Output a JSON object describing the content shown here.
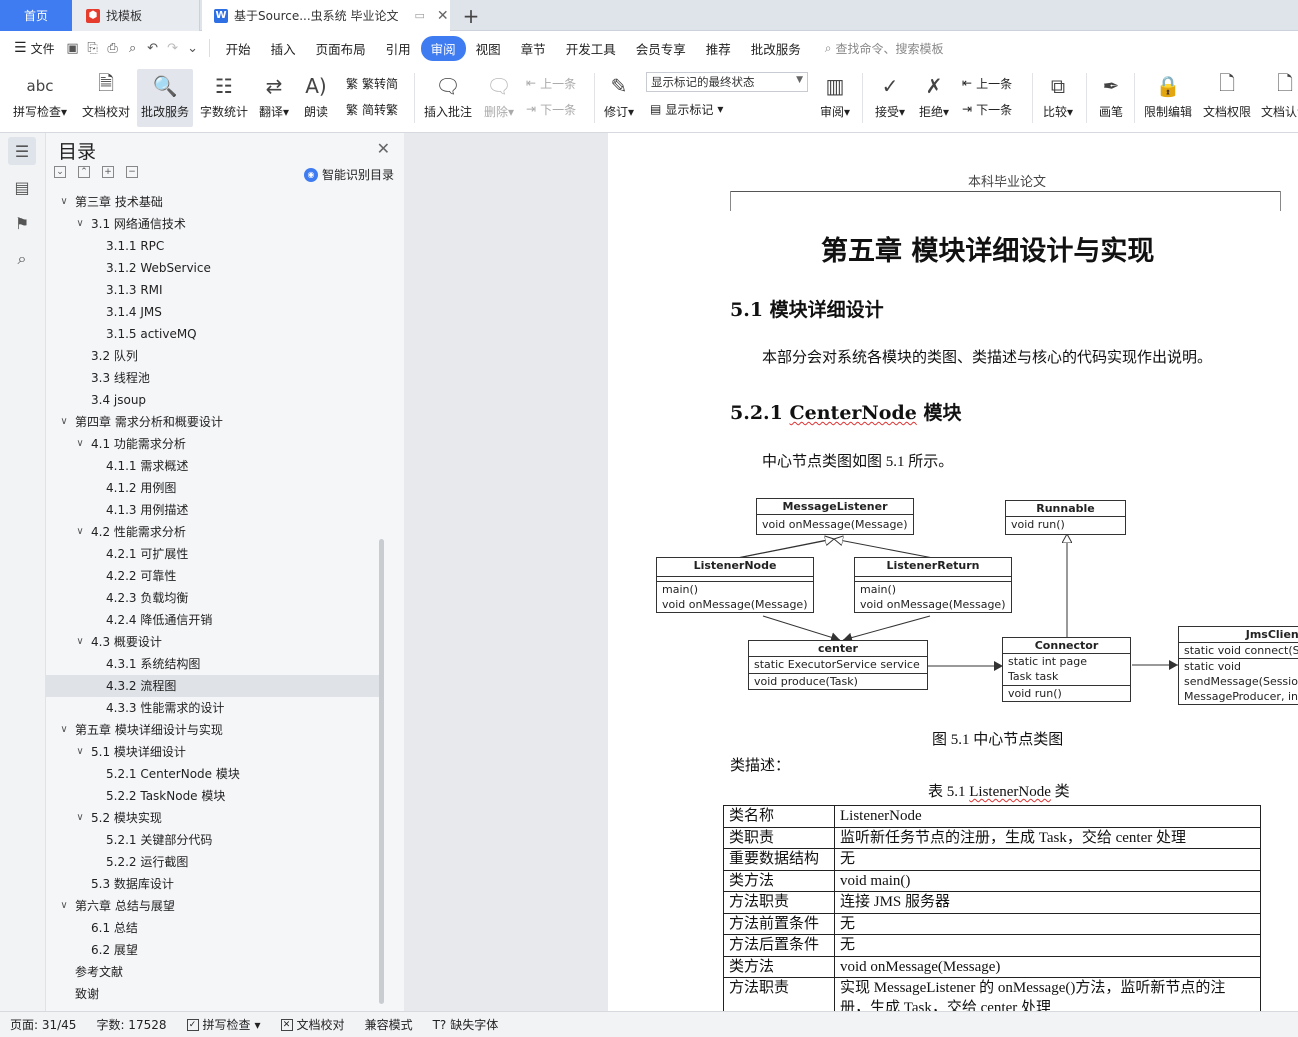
{
  "tabs": {
    "home": "首页",
    "template": "找模板",
    "document": "基于Source...虫系统 毕业论文"
  },
  "menu": {
    "file": "文件",
    "items": [
      "开始",
      "插入",
      "页面布局",
      "引用",
      "审阅",
      "视图",
      "章节",
      "开发工具",
      "会员专享",
      "推荐",
      "批改服务"
    ],
    "active_index": 4,
    "search_placeholder": "查找命令、搜索模板"
  },
  "ribbon": {
    "spell_icon_text": "abc",
    "spell": "拼写检查",
    "doc_check": "文档校对",
    "correction": "批改服务",
    "word_count": "字数统计",
    "translate": "翻译",
    "read_aloud": "朗读",
    "trad_to_simp": "繁转简",
    "simp_to_trad": "简转繁",
    "insert_comment": "插入批注",
    "delete": "删除",
    "prev": "上一条",
    "next": "下一条",
    "track": "修订",
    "markup_select": "显示标记的最终状态",
    "show_markup": "显示标记",
    "review": "审阅",
    "accept": "接受",
    "reject": "拒绝",
    "prev2": "上一条",
    "next2": "下一条",
    "compare": "比较",
    "brush": "画笔",
    "restrict": "限制编辑",
    "permission": "文档权限",
    "cert": "文档认证"
  },
  "toc": {
    "title": "目录",
    "smart": "智能识别目录",
    "items": [
      {
        "text": "第三章  技术基础",
        "level": 0,
        "chev": "v"
      },
      {
        "text": "3.1  网络通信技术",
        "level": 1,
        "chev": "v"
      },
      {
        "text": "3.1.1 RPC",
        "level": 2
      },
      {
        "text": "3.1.2 WebService",
        "level": 2
      },
      {
        "text": "3.1.3 RMI",
        "level": 2
      },
      {
        "text": "3.1.4 JMS",
        "level": 2
      },
      {
        "text": "3.1.5 activeMQ",
        "level": 2
      },
      {
        "text": "3.2  队列",
        "level": 1
      },
      {
        "text": "3.3  线程池",
        "level": 1
      },
      {
        "text": "3.4 jsoup",
        "level": 1
      },
      {
        "text": "第四章  需求分析和概要设计",
        "level": 0,
        "chev": "v"
      },
      {
        "text": "4.1  功能需求分析",
        "level": 1,
        "chev": "v"
      },
      {
        "text": "4.1.1  需求概述",
        "level": 2
      },
      {
        "text": "4.1.2  用例图",
        "level": 2
      },
      {
        "text": "4.1.3  用例描述",
        "level": 2
      },
      {
        "text": "4.2  性能需求分析",
        "level": 1,
        "chev": "v"
      },
      {
        "text": "4.2.1  可扩展性",
        "level": 2
      },
      {
        "text": "4.2.2  可靠性",
        "level": 2
      },
      {
        "text": "4.2.3  负载均衡",
        "level": 2
      },
      {
        "text": "4.2.4  降低通信开销",
        "level": 2
      },
      {
        "text": "4.3  概要设计",
        "level": 1,
        "chev": "v"
      },
      {
        "text": "4.3.1  系统结构图",
        "level": 2
      },
      {
        "text": "4.3.2  流程图",
        "level": 2,
        "selected": true
      },
      {
        "text": "4.3.3  性能需求的设计",
        "level": 2
      },
      {
        "text": "第五章  模块详细设计与实现",
        "level": 0,
        "chev": "v"
      },
      {
        "text": "5.1  模块详细设计",
        "level": 1,
        "chev": "v"
      },
      {
        "text": "5.2.1 CenterNode 模块",
        "level": 2
      },
      {
        "text": "5.2.2 TaskNode 模块",
        "level": 2
      },
      {
        "text": "5.2  模块实现",
        "level": 1,
        "chev": "v"
      },
      {
        "text": "5.2.1  关键部分代码",
        "level": 2
      },
      {
        "text": "5.2.2  运行截图",
        "level": 2
      },
      {
        "text": "5.3  数据库设计",
        "level": 1
      },
      {
        "text": "第六章  总结与展望",
        "level": 0,
        "chev": "v"
      },
      {
        "text": "6.1  总结",
        "level": 1
      },
      {
        "text": "6.2  展望",
        "level": 1
      },
      {
        "text": "参考文献",
        "level": 0
      },
      {
        "text": "致谢",
        "level": 0
      }
    ]
  },
  "page": {
    "header": "本科毕业论文",
    "chapter_title": "第五章  模块详细设计与实现",
    "section_title": "5.1  模块详细设计",
    "intro": "本部分会对系统各模块的类图、类描述与核心的代码实现作出说明。",
    "subsection_num": "5.2.1 ",
    "subsection_name": "CenterNode",
    "subsection_suffix": " 模块",
    "figure_ref": "中心节点类图如图 5.1 所示。",
    "figure_caption": "图 5.1  中心节点类图",
    "class_desc": "类描述：",
    "table_caption_prefix": "表 5.1 ",
    "table_caption_name": "ListenerNode",
    "table_caption_suffix": " 类"
  },
  "uml": {
    "message_listener": {
      "name": "MessageListener",
      "methods": [
        "void onMessage(Message)"
      ]
    },
    "runnable": {
      "name": "Runnable",
      "methods": [
        "void run()"
      ]
    },
    "listener_node": {
      "name": "ListenerNode",
      "methods": [
        "main()",
        "void onMessage(Message)"
      ]
    },
    "listener_return": {
      "name": "ListenerReturn",
      "methods": [
        "main()",
        "void onMessage(Message)"
      ]
    },
    "center": {
      "name": "center",
      "attrs": [
        "static ExecutorService service"
      ],
      "methods": [
        "void produce(Task)"
      ]
    },
    "connector": {
      "name": "Connector",
      "attrs": [
        "static int page",
        "Task task"
      ],
      "methods": [
        "void run()"
      ]
    },
    "jms_client": {
      "name": "JmsClient",
      "methods": [
        "static void connect(Str",
        "static void",
        "sendMessage(Session",
        "MessageProducer, int)"
      ]
    }
  },
  "table": [
    {
      "k": "类名称",
      "v": "ListenerNode"
    },
    {
      "k": "类职责",
      "v": "监听新任务节点的注册，生成 Task，交给 center 处理"
    },
    {
      "k": "重要数据结构",
      "v": "无"
    },
    {
      "k": "类方法",
      "v": "void main()"
    },
    {
      "k": "方法职责",
      "v": "连接 JMS 服务器"
    },
    {
      "k": "方法前置条件",
      "v": "无"
    },
    {
      "k": "方法后置条件",
      "v": "无"
    },
    {
      "k": "类方法",
      "v": "void onMessage(Message)"
    },
    {
      "k": "方法职责",
      "v": "实现 MessageListener 的 onMessage()方法，监听新节点的注册，生成 Task，交给 center 处理"
    }
  ],
  "status": {
    "page": "页面: 31/45",
    "words": "字数: 17528",
    "spell": "拼写检查",
    "doc_check": "文档校对",
    "compat": "兼容模式",
    "missing_font": "缺失字体"
  }
}
